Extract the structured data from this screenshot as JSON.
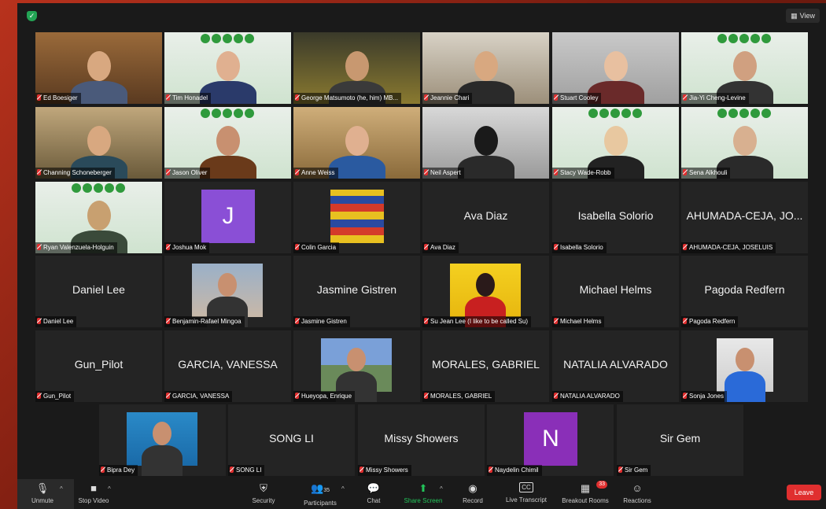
{
  "toolbar_top": {
    "view_label": "View",
    "view_icon": "grid-icon"
  },
  "tiles": [
    {
      "name": "Ed Boesiger",
      "type": "video"
    },
    {
      "name": "Tim Honadel",
      "type": "video"
    },
    {
      "name": "George Matsumoto (he, him) MB...",
      "type": "video"
    },
    {
      "name": "Jeannie Chari",
      "type": "video"
    },
    {
      "name": "Stuart Cooley",
      "type": "video"
    },
    {
      "name": "Jia-Yi Cheng-Levine",
      "type": "video"
    },
    {
      "name": "Channing Schoneberger",
      "type": "video"
    },
    {
      "name": "Jason Oliver",
      "type": "video"
    },
    {
      "name": "Anne Weiss",
      "type": "video",
      "active": true
    },
    {
      "name": "Neil Aspert",
      "type": "video"
    },
    {
      "name": "Stacy Wade-Robb",
      "type": "video"
    },
    {
      "name": "Sena Alkhouli",
      "type": "video"
    },
    {
      "name": "Ryan Valenzuela-Holguin",
      "type": "video"
    },
    {
      "name": "Joshua Mok",
      "type": "letter",
      "letter": "J",
      "color": "#8a4fd6"
    },
    {
      "name": "Colin Garcia",
      "type": "image"
    },
    {
      "name": "Ava Diaz",
      "type": "name",
      "display": "Ava Diaz"
    },
    {
      "name": "Isabella Solorio",
      "type": "name",
      "display": "Isabella Solorio"
    },
    {
      "name": "AHUMADA-CEJA, JOSELUIS",
      "type": "name",
      "display": "AHUMADA-CEJA, JO..."
    },
    {
      "name": "Daniel Lee",
      "type": "name",
      "display": "Daniel Lee"
    },
    {
      "name": "Benjamin-Rafael Mingoa",
      "type": "image"
    },
    {
      "name": "Jasmine Gistren",
      "type": "name",
      "display": "Jasmine Gistren"
    },
    {
      "name": "Su Jean Lee (I like to be called Su)",
      "type": "image"
    },
    {
      "name": "Michael Helms",
      "type": "name",
      "display": "Michael Helms"
    },
    {
      "name": "Pagoda Redfern",
      "type": "name",
      "display": "Pagoda Redfern"
    },
    {
      "name": "Gun_Pilot",
      "type": "name",
      "display": "Gun_Pilot"
    },
    {
      "name": "GARCIA, VANESSA",
      "type": "name",
      "display": "GARCIA, VANESSA"
    },
    {
      "name": "Hueyopa, Enrique",
      "type": "image"
    },
    {
      "name": "MORALES, GABRIEL",
      "type": "name",
      "display": "MORALES, GABRIEL"
    },
    {
      "name": "NATALIA ALVARADO",
      "type": "name",
      "display": "NATALIA ALVARADO"
    },
    {
      "name": "Sonja Jones",
      "type": "image"
    },
    {
      "name": "Bipra Dey",
      "type": "image"
    },
    {
      "name": "SONG LI",
      "type": "name",
      "display": "SONG LI"
    },
    {
      "name": "Missy Showers",
      "type": "name",
      "display": "Missy Showers"
    },
    {
      "name": "Naydelin Chimil",
      "type": "letter",
      "letter": "N",
      "color": "#8a2fb8"
    },
    {
      "name": "Sir Gem",
      "type": "name",
      "display": "Sir Gem"
    }
  ],
  "bottombar": {
    "unmute": "Unmute",
    "stop_video": "Stop Video",
    "security": "Security",
    "participants": "Participants",
    "participants_count": "35",
    "chat": "Chat",
    "share_screen": "Share Screen",
    "record": "Record",
    "live_transcript": "Live Transcript",
    "breakout_rooms": "Breakout Rooms",
    "breakout_badge": "33",
    "reactions": "Reactions",
    "leave": "Leave",
    "cc_icon_text": "CC"
  },
  "colors": {
    "accent_green": "#23c45a",
    "leave_red": "#e02f2f",
    "active_border": "#d6e35a"
  }
}
